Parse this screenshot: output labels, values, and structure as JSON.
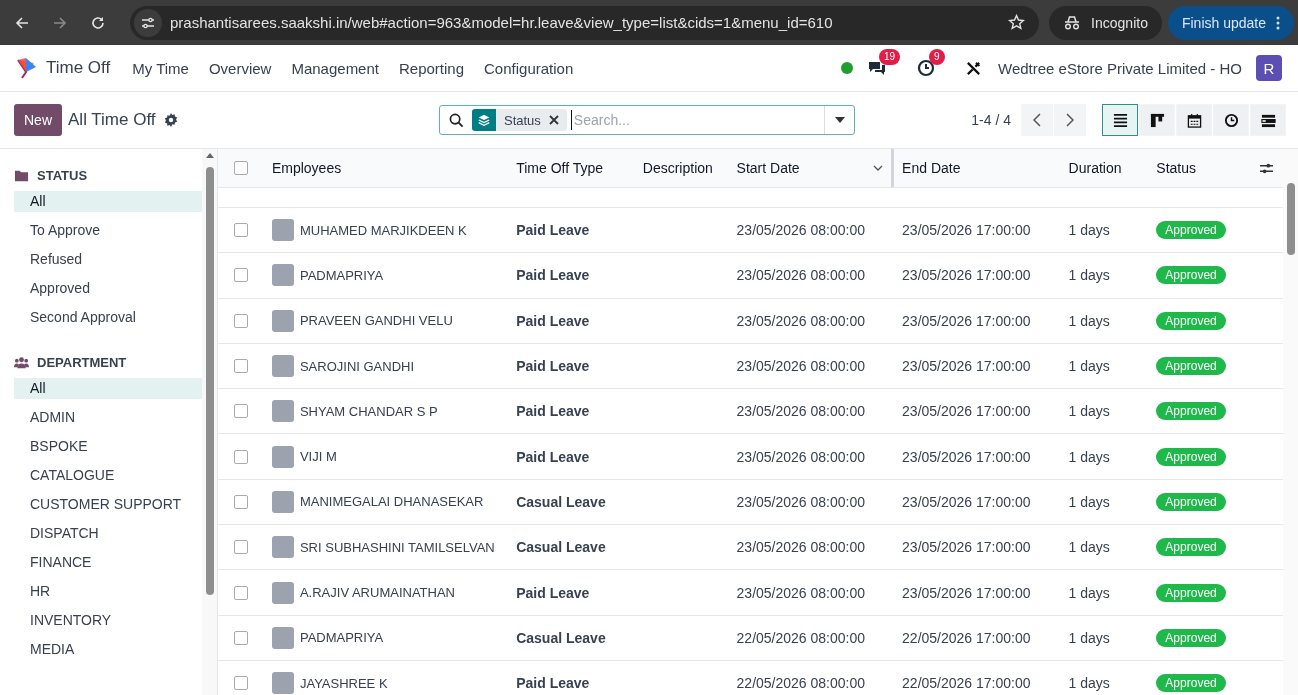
{
  "browser": {
    "url": "prashantisarees.saakshi.in/web#action=963&model=hr.leave&view_type=list&cids=1&menu_id=610",
    "incognito": "Incognito",
    "update_button": "Finish update"
  },
  "navbar": {
    "app_name": "Time Off",
    "menu": [
      "My Time",
      "Overview",
      "Management",
      "Reporting",
      "Configuration"
    ],
    "presence_online": true,
    "messages_count": "19",
    "activities_count": "9",
    "company": "Wedtree eStore Private Limited - HO",
    "user_initial": "R"
  },
  "control_panel": {
    "new_button": "New",
    "title": "All Time Off",
    "facet": "Status",
    "search": {
      "placeholder": "Search..."
    },
    "pager": "1-4 / 4",
    "views": [
      {
        "kind": "list",
        "selected": true
      },
      {
        "kind": "kanban",
        "selected": false
      },
      {
        "kind": "calendar",
        "selected": false
      },
      {
        "kind": "activity",
        "selected": false
      },
      {
        "kind": "gantt",
        "selected": false
      }
    ]
  },
  "sidebar": {
    "sections": [
      {
        "kind": "status",
        "title": "STATUS",
        "items": [
          {
            "label": "All",
            "selected": true
          },
          {
            "label": "To Approve",
            "selected": false
          },
          {
            "label": "Refused",
            "selected": false
          },
          {
            "label": "Approved",
            "selected": false
          },
          {
            "label": "Second Approval",
            "selected": false
          }
        ]
      },
      {
        "kind": "department",
        "title": "DEPARTMENT",
        "items": [
          {
            "label": "All",
            "selected": true
          },
          {
            "label": "ADMIN",
            "selected": false
          },
          {
            "label": "BSPOKE",
            "selected": false
          },
          {
            "label": "CATALOGUE",
            "selected": false
          },
          {
            "label": "CUSTOMER SUPPORT",
            "selected": false
          },
          {
            "label": "DISPATCH",
            "selected": false
          },
          {
            "label": "FINANCE",
            "selected": false
          },
          {
            "label": "HR",
            "selected": false
          },
          {
            "label": "INVENTORY",
            "selected": false
          },
          {
            "label": "MEDIA",
            "selected": false
          }
        ]
      }
    ]
  },
  "table": {
    "all_checked": false,
    "columns": [
      {
        "label": "Employees",
        "sorted": false
      },
      {
        "label": "Time Off Type",
        "sorted": false
      },
      {
        "label": "Description",
        "sorted": false
      },
      {
        "label": "Start Date",
        "sorted": true
      },
      {
        "label": "End Date",
        "sorted": false
      },
      {
        "label": "Duration",
        "sorted": false
      },
      {
        "label": "Status",
        "sorted": false
      }
    ],
    "rows": [
      {
        "employee": "MUHAMED MARJIKDEEN K",
        "type": "Paid Leave",
        "start": "23/05/2026 08:00:00",
        "end": "23/05/2026 17:00:00",
        "duration": "1 days",
        "status": "Approved",
        "checked": false
      },
      {
        "employee": "PADMAPRIYA",
        "type": "Paid Leave",
        "start": "23/05/2026 08:00:00",
        "end": "23/05/2026 17:00:00",
        "duration": "1 days",
        "status": "Approved",
        "checked": false
      },
      {
        "employee": "PRAVEEN GANDHI VELU",
        "type": "Paid Leave",
        "start": "23/05/2026 08:00:00",
        "end": "23/05/2026 17:00:00",
        "duration": "1 days",
        "status": "Approved",
        "checked": false
      },
      {
        "employee": "SAROJINI GANDHI",
        "type": "Paid Leave",
        "start": "23/05/2026 08:00:00",
        "end": "23/05/2026 17:00:00",
        "duration": "1 days",
        "status": "Approved",
        "checked": false
      },
      {
        "employee": "SHYAM CHANDAR S P",
        "type": "Paid Leave",
        "start": "23/05/2026 08:00:00",
        "end": "23/05/2026 17:00:00",
        "duration": "1 days",
        "status": "Approved",
        "checked": false
      },
      {
        "employee": "VIJI M",
        "type": "Paid Leave",
        "start": "23/05/2026 08:00:00",
        "end": "23/05/2026 17:00:00",
        "duration": "1 days",
        "status": "Approved",
        "checked": false
      },
      {
        "employee": "MANIMEGALAI DHANASEKAR",
        "type": "Casual Leave",
        "start": "23/05/2026 08:00:00",
        "end": "23/05/2026 17:00:00",
        "duration": "1 days",
        "status": "Approved",
        "checked": false
      },
      {
        "employee": "SRI SUBHASHINI TAMILSELVAN",
        "type": "Casual Leave",
        "start": "23/05/2026 08:00:00",
        "end": "23/05/2026 17:00:00",
        "duration": "1 days",
        "status": "Approved",
        "checked": false
      },
      {
        "employee": "A.RAJIV ARUMAINATHAN",
        "type": "Paid Leave",
        "start": "23/05/2026 08:00:00",
        "end": "23/05/2026 17:00:00",
        "duration": "1 days",
        "status": "Approved",
        "checked": false
      },
      {
        "employee": "PADMAPRIYA",
        "type": "Casual Leave",
        "start": "22/05/2026 08:00:00",
        "end": "22/05/2026 17:00:00",
        "duration": "1 days",
        "status": "Approved",
        "checked": false
      },
      {
        "employee": "JAYASHREE K",
        "type": "Paid Leave",
        "start": "22/05/2026 08:00:00",
        "end": "22/05/2026 17:00:00",
        "duration": "1 days",
        "status": "Approved",
        "checked": false
      }
    ]
  }
}
